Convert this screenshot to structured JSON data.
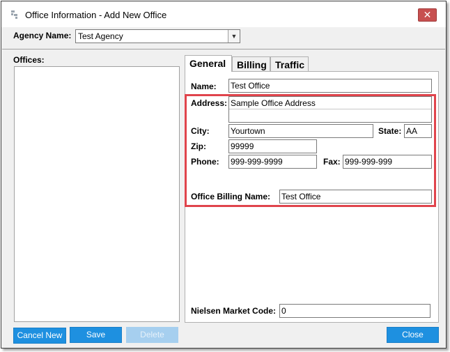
{
  "window": {
    "title": "Office Information - Add New Office",
    "close_glyph": "✕"
  },
  "agency": {
    "label": "Agency Name:",
    "value": "Test Agency"
  },
  "offices": {
    "label": "Offices:"
  },
  "tabs": [
    {
      "label": "General",
      "active": true
    },
    {
      "label": "Billing",
      "active": false
    },
    {
      "label": "Traffic",
      "active": false
    }
  ],
  "general": {
    "name_label": "Name:",
    "name_value": "Test Office",
    "address_label": "Address:",
    "address_line1": "Sample Office Address",
    "address_line2": "",
    "city_label": "City:",
    "city_value": "Yourtown",
    "state_label": "State:",
    "state_value": "AA",
    "zip_label": "Zip:",
    "zip_value": "99999",
    "phone_label": "Phone:",
    "phone_value": "999-999-9999",
    "fax_label": "Fax:",
    "fax_value": "999-999-999",
    "billing_name_label": "Office Billing Name:",
    "billing_name_value": "Test Office",
    "nielsen_label": "Nielsen Market Code:",
    "nielsen_value": "0"
  },
  "buttons": {
    "cancel_new": "Cancel New",
    "save": "Save",
    "delete": "Delete",
    "close": "Close"
  },
  "colors": {
    "accent": "#1e90e0",
    "highlight_border": "#e0444c",
    "close_button": "#c75050"
  }
}
